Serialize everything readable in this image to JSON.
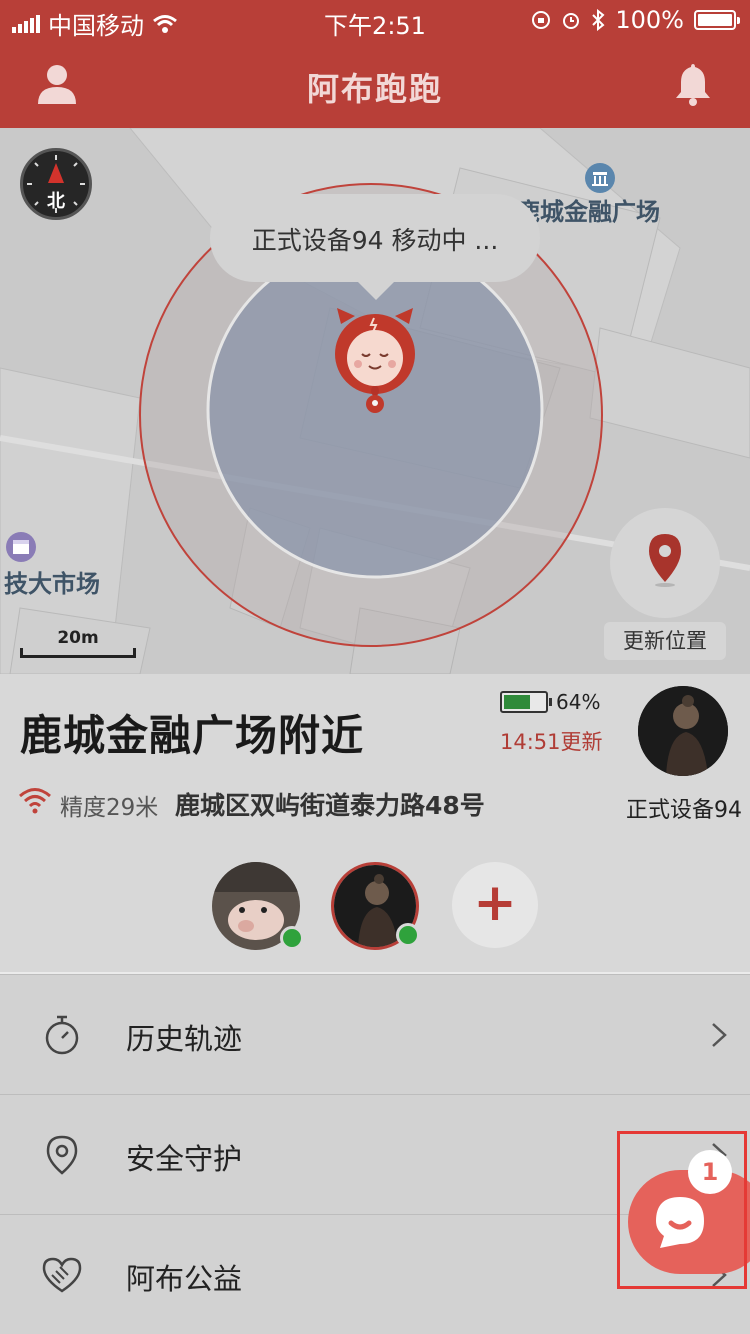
{
  "status_bar": {
    "carrier": "中国移动",
    "time": "下午2:51",
    "battery": "100%"
  },
  "header": {
    "title": "阿布跑跑"
  },
  "map": {
    "compass_label": "北",
    "labels": {
      "finance_plaza": "鹿城金融广场",
      "market": "技大市场"
    },
    "bubble_text": "正式设备94 移动中 ...",
    "update_location_label": "更新位置",
    "scale": "20m"
  },
  "info": {
    "place_name": "鹿城金融广场附近",
    "battery_percent": "64%",
    "battery_level": 0.64,
    "update_time": "14:51更新",
    "accuracy": "精度29米",
    "address": "鹿城区双屿街道泰力路48号",
    "device_name": "正式设备94"
  },
  "menu": {
    "items": [
      {
        "label": "历史轨迹",
        "icon": "stopwatch-icon"
      },
      {
        "label": "安全守护",
        "icon": "location-pin-icon"
      },
      {
        "label": "阿布公益",
        "icon": "heart-handshake-icon"
      }
    ]
  },
  "chat": {
    "badge": "1"
  },
  "colors": {
    "brand": "#b83f38",
    "accent": "#e5625b",
    "online": "#2fa23c"
  }
}
